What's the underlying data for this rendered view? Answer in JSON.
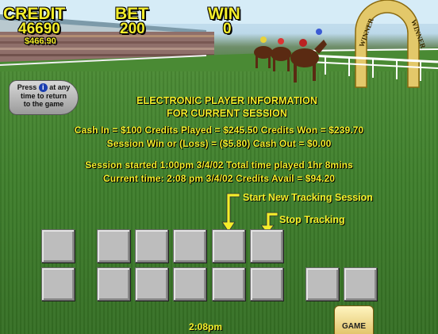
{
  "meter": {
    "credit_label": "CREDIT",
    "credit_value": "46690",
    "credit_dollars": "$466.90",
    "bet_label": "BET",
    "bet_value": "200",
    "win_label": "WIN",
    "win_value": "0"
  },
  "return_button": {
    "line1_pre": "Press",
    "icon_glyph": "i",
    "line1_post": "at any",
    "line2": "time to return",
    "line3": "to the game"
  },
  "info": {
    "title1": "ELECTRONIC PLAYER INFORMATION",
    "title2": "FOR CURRENT SESSION",
    "line1": "Cash In = $100   Credits Played = $245.50   Credits Won = $239.70",
    "line2": "Session Win or (Loss) = ($5.80)  Cash Out = $0.00",
    "line3": "Session started 1:00pm 3/4/02    Total time played 1hr 8mins",
    "line4": "Current time: 2:08 pm 3/4/02    Credits Avail = $94.20"
  },
  "callouts": {
    "start": "Start New Tracking Session",
    "stop": "Stop Tracking"
  },
  "sign": {
    "text_left": "WINNER",
    "text_right": "WINNER"
  },
  "footer": {
    "clock": "2:08pm",
    "game_button": "GAME"
  },
  "icons": [
    "info-icon",
    "arrow-down-icon"
  ],
  "colors": {
    "text_accent": "#f4ee2a",
    "button_gray": "#bdbdbd"
  }
}
